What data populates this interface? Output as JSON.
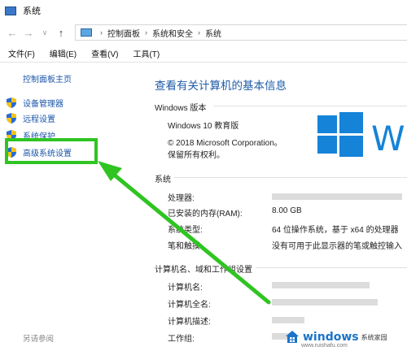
{
  "window": {
    "title": "系统"
  },
  "nav": {
    "breadcrumb": [
      "控制面板",
      "系统和安全",
      "系统"
    ]
  },
  "menu": [
    "文件(F)",
    "编辑(E)",
    "查看(V)",
    "工具(T)"
  ],
  "sidebar": {
    "home": "控制面板主页",
    "items": [
      {
        "label": "设备管理器"
      },
      {
        "label": "远程设置"
      },
      {
        "label": "系统保护"
      },
      {
        "label": "高级系统设置"
      }
    ],
    "see_also": "另请参阅"
  },
  "main": {
    "title": "查看有关计算机的基本信息",
    "edition": {
      "heading": "Windows 版本",
      "name": "Windows 10 教育版",
      "copyright": "© 2018 Microsoft Corporation。",
      "rights": "保留所有权利。",
      "logo_text": "Wi"
    },
    "system": {
      "heading": "系统",
      "rows": [
        {
          "label": "处理器:",
          "value": ""
        },
        {
          "label": "已安装的内存(RAM):",
          "value": "8.00 GB"
        },
        {
          "label": "系统类型:",
          "value": "64 位操作系统，基于 x64 的处理器"
        },
        {
          "label": "笔和触摸:",
          "value": "没有可用于此显示器的笔或触控输入"
        }
      ]
    },
    "computer": {
      "heading": "计算机名、域和工作组设置",
      "rows": [
        {
          "label": "计算机名:"
        },
        {
          "label": "计算机全名:"
        },
        {
          "label": "计算机描述:"
        },
        {
          "label": "工作组:"
        }
      ]
    }
  },
  "watermark": {
    "brand": "windows",
    "sub": "系统家园",
    "url": "www.ruishafu.com"
  },
  "colors": {
    "link": "#1b56a8",
    "title": "#1e5ba8",
    "highlight": "#2fc422",
    "logo": "#1583d8"
  }
}
